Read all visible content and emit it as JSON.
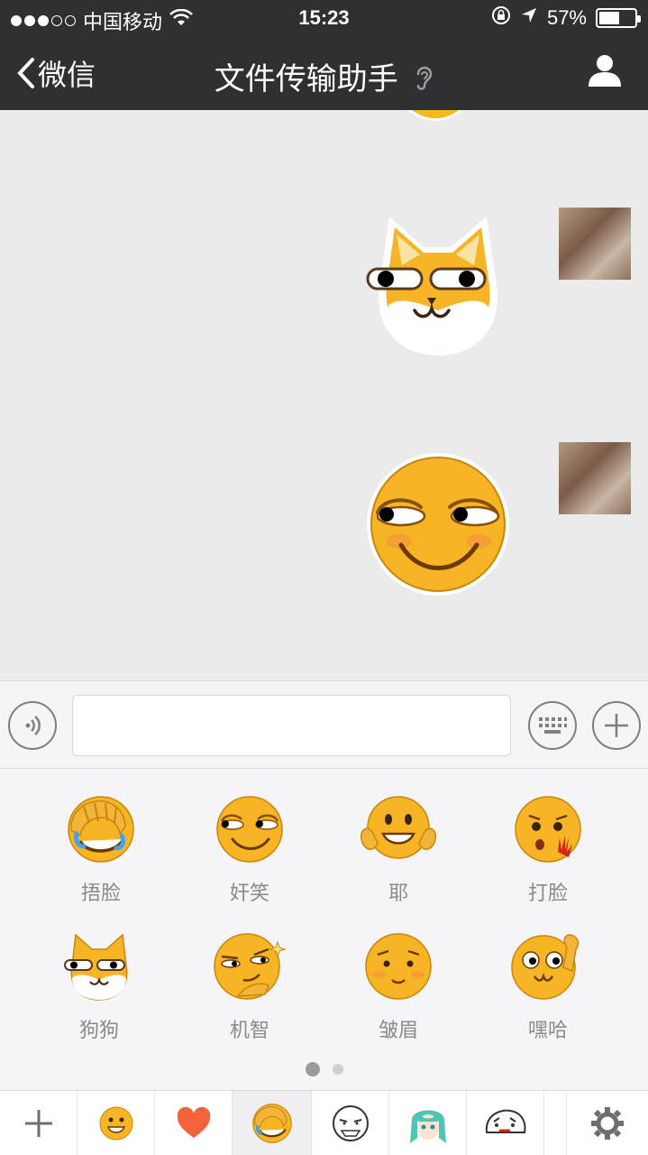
{
  "status_bar": {
    "carrier": "中国移动",
    "time": "15:23",
    "battery": "57%",
    "battery_level": 0.57
  },
  "nav": {
    "back_label": "微信",
    "title": "文件传输助手"
  },
  "emoji_panel": {
    "items": [
      {
        "label": "捂脸",
        "icon": "facepalm-icon"
      },
      {
        "label": "奸笑",
        "icon": "smirk-icon"
      },
      {
        "label": "耶",
        "icon": "yeah-icon"
      },
      {
        "label": "打脸",
        "icon": "slap-face-icon"
      },
      {
        "label": "狗狗",
        "icon": "doge-icon"
      },
      {
        "label": "机智",
        "icon": "smart-icon"
      },
      {
        "label": "皱眉",
        "icon": "frown-icon"
      },
      {
        "label": "嘿哈",
        "icon": "heyha-icon"
      }
    ],
    "page_count": 2,
    "current_page": 1
  },
  "tab_bar": {
    "tabs": [
      "add-icon",
      "emoji-icon",
      "heart-icon",
      "facepalm-icon",
      "meme-face-icon",
      "miku-icon",
      "cartoon-icon",
      "settings-icon"
    ],
    "selected": "facepalm-icon"
  },
  "colors": {
    "nav_background": "#2f3034",
    "emoji_yellow": "#f6b820",
    "chat_background": "#ebebeb"
  }
}
